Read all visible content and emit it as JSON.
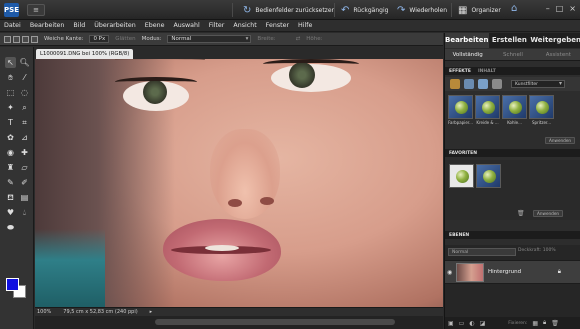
{
  "app": {
    "logo_text": "PSE",
    "menu_icon": "hamburger-icon",
    "reset_panels": "Bedienfelder zurücksetzen",
    "undo": "Rückgängig",
    "redo": "Wiederholen",
    "organizer": "Organizer",
    "home_icon": "home-icon",
    "window_buttons": [
      "–",
      "□",
      "×"
    ]
  },
  "menu": [
    "Datei",
    "Bearbeiten",
    "Bild",
    "Überarbeiten",
    "Ebene",
    "Auswahl",
    "Filter",
    "Ansicht",
    "Fenster",
    "Hilfe"
  ],
  "options": {
    "feather_label": "Weiche Kante:",
    "feather_value": "0 Px",
    "smooth_label": "Glätten",
    "mode_label": "Modus:",
    "mode_value": "Normal",
    "width_label": "Breite:",
    "height_label": "Höhe:"
  },
  "document": {
    "tab_title": "L1000091.DNG bei 100% (RGB/8)",
    "zoom": "100%",
    "dimensions": "79,5 cm x 52,83 cm (240 ppi)"
  },
  "colors": {
    "foreground": "#1010e0",
    "background": "#ffffff",
    "accent": "#1e5aa8"
  },
  "panel": {
    "mode_tabs": [
      "Bearbeiten",
      "Erstellen",
      "Weitergeben"
    ],
    "sub_tabs": [
      "Vollständig",
      "Schnell",
      "Assistent"
    ],
    "effects_header": [
      "EFFEKTE",
      "INHALT"
    ],
    "effects_filter": "Kunstfilter",
    "effects": [
      "Farbpapier...",
      "Kreide & ...",
      "Kohle...",
      "Spritzer..."
    ],
    "apply_label": "Anwenden",
    "favorites_header": "FAVORITEN",
    "layers_header": "EBENEN",
    "layer_mode": "Normal",
    "layer_opacity_label": "Deckkraft:",
    "layer_opacity_value": "100%",
    "layer_name": "Hintergrund",
    "layer_footer_labels": [
      "Fixieren:"
    ]
  }
}
